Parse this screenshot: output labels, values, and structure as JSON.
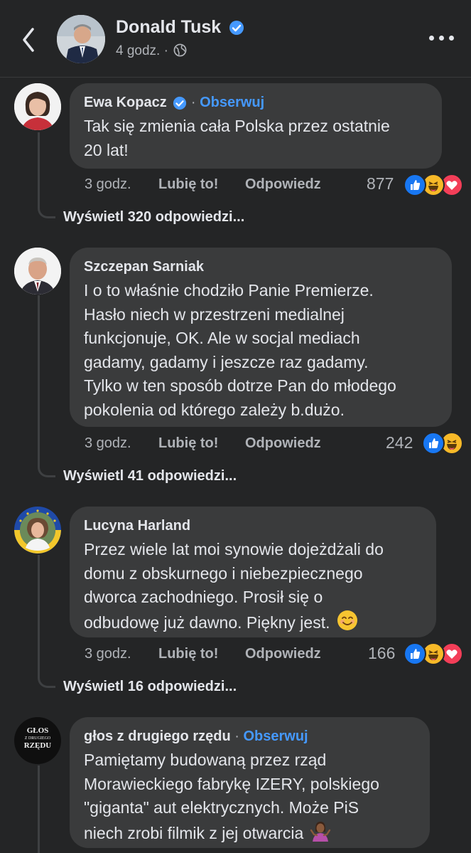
{
  "header": {
    "name": "Donald Tusk",
    "time": "4 godz.",
    "separator": "·"
  },
  "comments": [
    {
      "author": "Ewa Kopacz",
      "verified": true,
      "separator": "·",
      "follow": "Obserwuj",
      "lines": [
        "Tak się zmienia cała Polska przez ostatnie",
        "20 lat!"
      ],
      "time": "3 godz.",
      "like": "Lubię to!",
      "reply": "Odpowiedz",
      "reaction_count": "877",
      "reactions": [
        "like",
        "haha",
        "love"
      ],
      "view_replies": "Wyświetl 320 odpowiedzi..."
    },
    {
      "author": "Szczepan Sarniak",
      "lines": [
        "I o to właśnie chodziło Panie Premierze.",
        "Hasło niech w przestrzeni medialnej",
        "funkcjonuje, OK. Ale w socjal mediach",
        "gadamy, gadamy i jeszcze raz gadamy.",
        "Tylko w ten sposób dotrze Pan do młodego",
        "pokolenia od którego zależy b.dużo."
      ],
      "time": "3 godz.",
      "like": "Lubię to!",
      "reply": "Odpowiedz",
      "reaction_count": "242",
      "reactions": [
        "like",
        "haha"
      ],
      "view_replies": "Wyświetl 41 odpowiedzi..."
    },
    {
      "author": "Lucyna Harland",
      "lines": [
        "Przez wiele lat moi synowie dojeżdżali do",
        "domu z obskurnego i niebezpiecznego",
        "dworca zachodniego. Prosił się o",
        "odbudowę już dawno. Piękny jest."
      ],
      "time": "3 godz.",
      "like": "Lubię to!",
      "reply": "Odpowiedz",
      "reaction_count": "166",
      "reactions": [
        "like",
        "haha",
        "love"
      ],
      "view_replies": "Wyświetl 16 odpowiedzi..."
    },
    {
      "author": "głos z drugiego rzędu",
      "separator": "·",
      "follow": "Obserwuj",
      "avatar_text": [
        "GŁOS",
        "Z DRUGIEGO",
        "RZĘDU"
      ],
      "lines": [
        "Pamiętamy budowaną przez rząd",
        "Morawieckiego fabrykę IZERY, polskiego",
        "\"giganta\" aut elektrycznych. Może PiS",
        "niech zrobi filmik z jej otwarcia"
      ]
    }
  ],
  "colors": {
    "background": "#242526",
    "bubble": "#3a3b3c",
    "accent": "#4599ff",
    "secondary_text": "#b0b3b8",
    "like": "#1877f2",
    "love": "#f33e58",
    "haha": "#f7b928"
  },
  "icons": [
    "back-chevron-icon",
    "verified-badge-icon",
    "globe-icon",
    "more-icon",
    "like-reaction-icon",
    "haha-reaction-icon",
    "love-reaction-icon",
    "smile-emoji-icon",
    "shrug-emoji-icon"
  ]
}
